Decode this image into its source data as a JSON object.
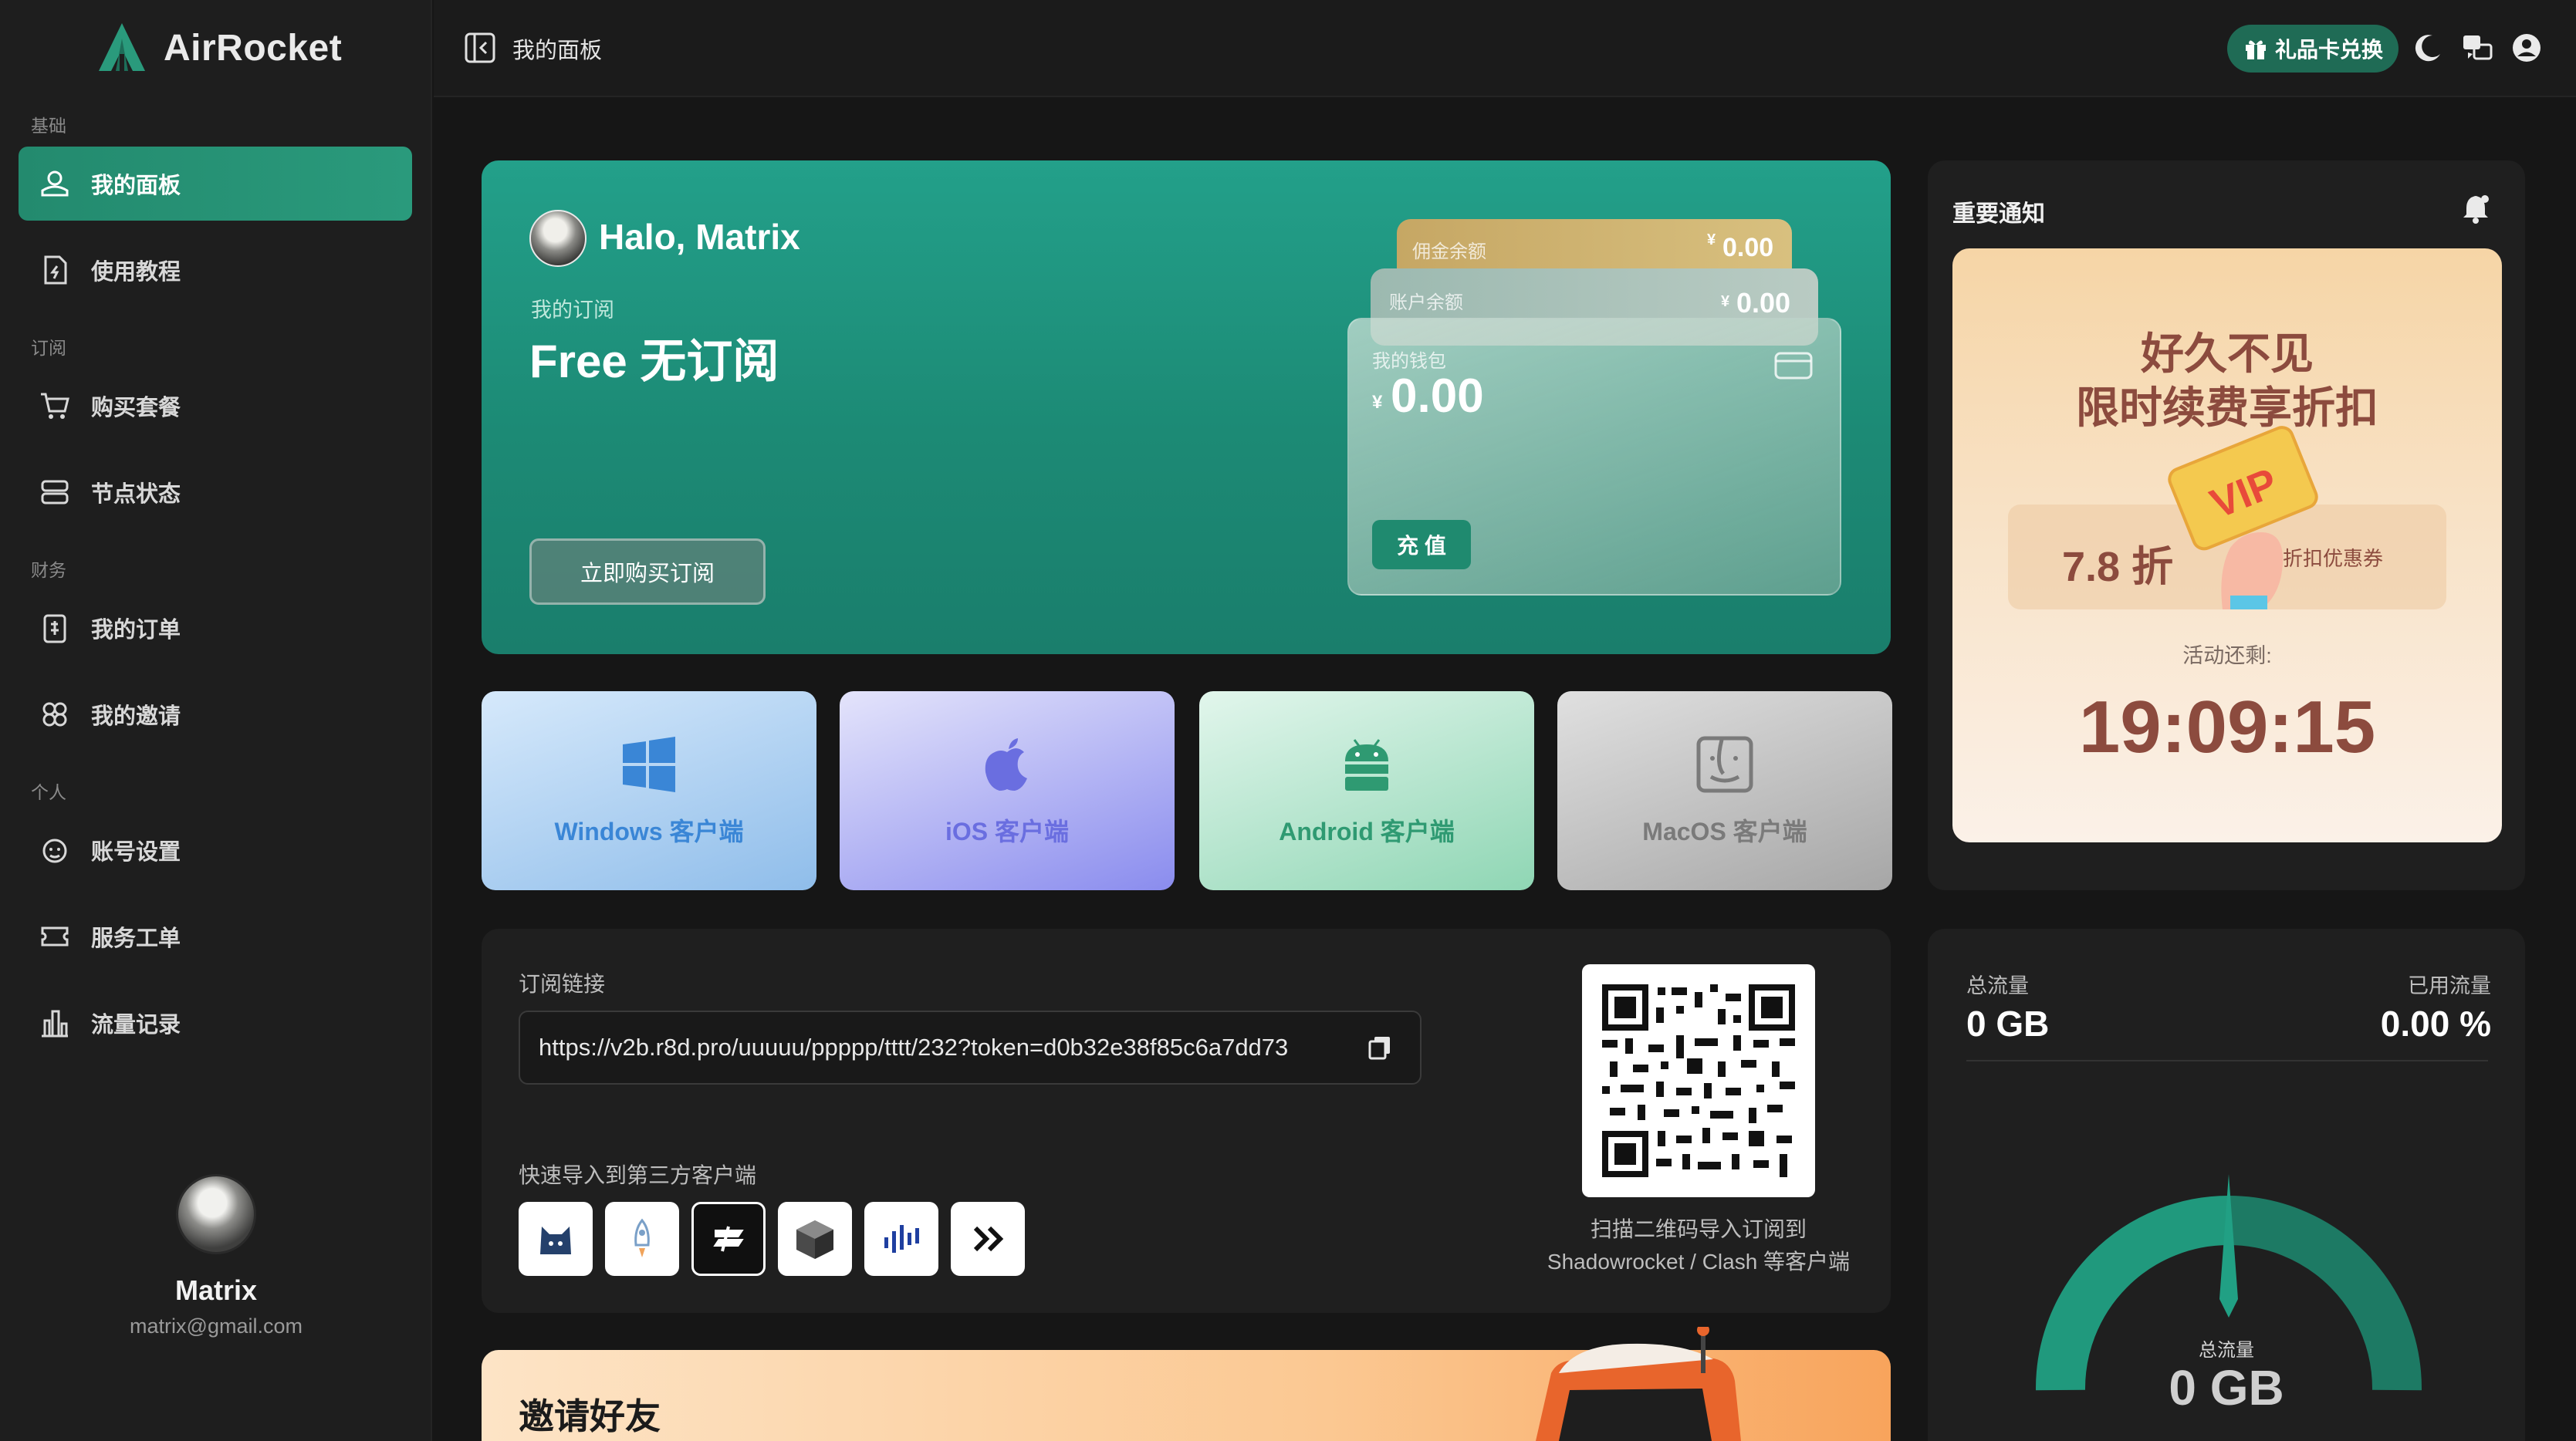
{
  "brand": {
    "name": "AirRocket"
  },
  "sidebar": {
    "sections": [
      {
        "label": "基础",
        "items": [
          {
            "label": "我的面板",
            "icon": "dashboard-icon",
            "active": true
          },
          {
            "label": "使用教程",
            "icon": "tutorial-icon"
          }
        ]
      },
      {
        "label": "订阅",
        "items": [
          {
            "label": "购买套餐",
            "icon": "cart-icon"
          },
          {
            "label": "节点状态",
            "icon": "server-icon"
          }
        ]
      },
      {
        "label": "财务",
        "items": [
          {
            "label": "我的订单",
            "icon": "order-icon"
          },
          {
            "label": "我的邀请",
            "icon": "invite-icon"
          }
        ]
      },
      {
        "label": "个人",
        "items": [
          {
            "label": "账号设置",
            "icon": "account-icon"
          },
          {
            "label": "服务工单",
            "icon": "ticket-icon"
          },
          {
            "label": "流量记录",
            "icon": "traffic-log-icon"
          }
        ]
      }
    ],
    "user": {
      "name": "Matrix",
      "email": "matrix@gmail.com"
    }
  },
  "topbar": {
    "title": "我的面板",
    "gift_button": "礼品卡兑换",
    "icons": [
      "moon-icon",
      "translate-icon",
      "user-circle-icon"
    ]
  },
  "hero": {
    "greeting": "Halo, Matrix",
    "subscription_label": "我的订阅",
    "plan": "Free 无订阅",
    "buy_button": "立即购买订阅",
    "wallet": {
      "commission_label": "佣金余额",
      "commission_value": "0.00",
      "account_label": "账户余额",
      "account_value": "0.00",
      "wallet_label": "我的钱包",
      "wallet_value": "0.00",
      "currency": "¥",
      "recharge_button": "充 值"
    }
  },
  "clients": [
    {
      "label": "Windows 客户端",
      "icon": "windows-icon",
      "color": "#3a86d6"
    },
    {
      "label": "iOS 客户端",
      "icon": "apple-icon",
      "color": "#6a6ee0"
    },
    {
      "label": "Android 客户端",
      "icon": "android-icon",
      "color": "#2f9a72"
    },
    {
      "label": "MacOS 客户端",
      "icon": "finder-icon",
      "color": "#7a7a7a"
    }
  ],
  "notice": {
    "title": "重要通知",
    "promo_line1": "好久不见",
    "promo_line2": "限时续费享折扣",
    "coupon_discount": "7.8 折",
    "coupon_label": "折扣优惠券",
    "countdown_label": "活动还剩:",
    "countdown": "19:09:15"
  },
  "subscription": {
    "label": "订阅链接",
    "url": "https://v2b.r8d.pro/uuuuu/ppppp/tttt/232?token=d0b32e38f85c6a7dd73",
    "import_label": "快速导入到第三方客户端",
    "apps": [
      "clash-icon",
      "shadowrocket-icon",
      "stash-icon",
      "surge-icon",
      "quantumult-icon",
      "more-icon"
    ],
    "qr_caption1": "扫描二维码导入订阅到",
    "qr_caption2": "Shadowrocket / Clash 等客户端"
  },
  "traffic": {
    "total_label": "总流量",
    "total_value": "0 GB",
    "used_label": "已用流量",
    "used_value": "0.00 %",
    "used_fraction": 0.0,
    "gauge_label": "总流量",
    "gauge_value": "0 GB"
  },
  "invite": {
    "title": "邀请好友"
  }
}
